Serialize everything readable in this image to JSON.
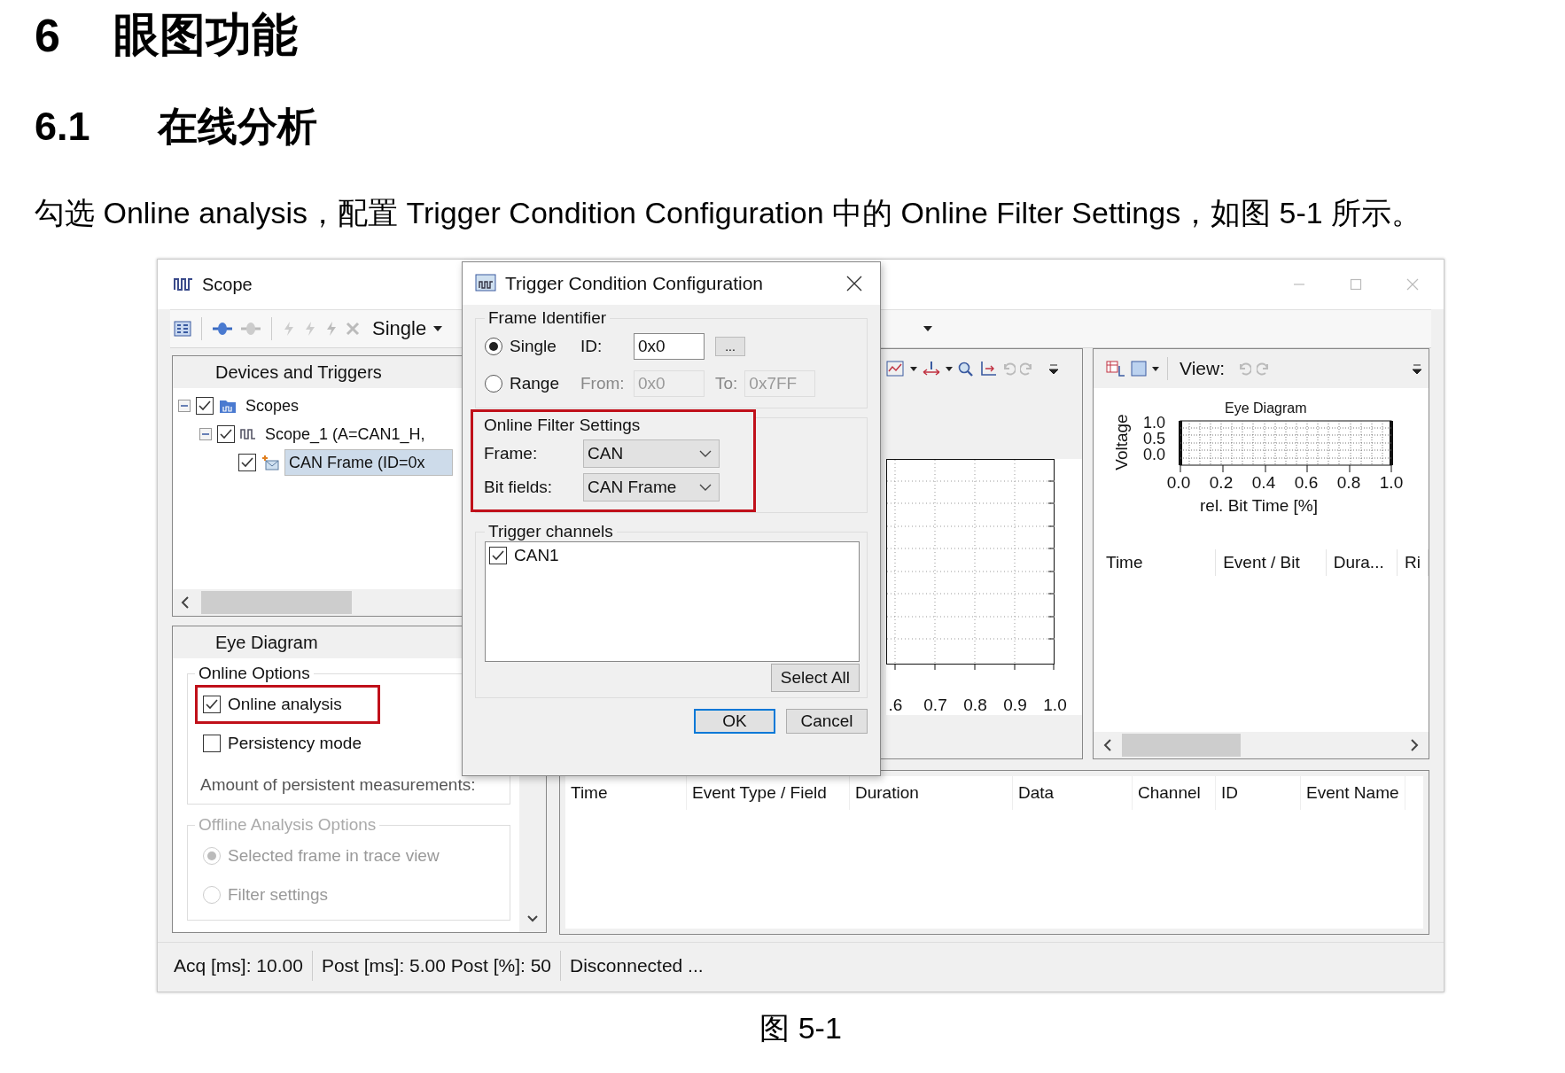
{
  "doc": {
    "heading1": {
      "number": "6",
      "title": "眼图功能"
    },
    "heading2": {
      "number": "6.1",
      "title": "在线分析"
    },
    "paragraph": "勾选 Online analysis，配置 Trigger Condition Configuration 中的 Online Filter Settings，如图 5-1 所示。",
    "caption": "图 5-1"
  },
  "window": {
    "title": "Scope"
  },
  "toolbar": {
    "mode": "Single"
  },
  "devices_panel": {
    "title": "Devices and Triggers",
    "tree": [
      {
        "label": "Scopes",
        "kind": "folder",
        "checked": true,
        "expanded": true,
        "selected": false,
        "children": [
          {
            "label": "Scope_1 (A=CAN1_H,",
            "kind": "scope",
            "checked": true,
            "expanded": true,
            "selected": false,
            "children": [
              {
                "label": "CAN Frame (ID=0x",
                "kind": "frame",
                "checked": true,
                "selected": true
              }
            ]
          }
        ]
      }
    ]
  },
  "eye_panel": {
    "title": "Eye Diagram",
    "online_options": {
      "title": "Online Options",
      "items": [
        {
          "label": "Online analysis",
          "checked": true,
          "highlighted": true
        },
        {
          "label": "Persistency mode",
          "checked": false,
          "highlighted": false
        }
      ],
      "amount_label": "Amount of persistent measurements:"
    },
    "offline_options": {
      "title": "Offline Analysis Options",
      "disabled": true,
      "items": [
        {
          "label": "Selected frame in trace view",
          "selected": true
        },
        {
          "label": "Filter settings",
          "selected": false
        }
      ]
    }
  },
  "scope_chart": {
    "x_tick_labels": [
      ".6",
      "0.7",
      "0.8",
      "0.9",
      "1.0"
    ]
  },
  "eye_view": {
    "view_label": "View:",
    "chart": {
      "title": "Eye Diagram",
      "ylabel": "Voltage",
      "y_tick_labels": [
        "1.0",
        "0.5",
        "0.0"
      ],
      "x_tick_labels": [
        "0.0",
        "0.2",
        "0.4",
        "0.6",
        "0.8",
        "1.0"
      ],
      "xlabel": "rel. Bit Time [%]"
    },
    "columns": [
      "Time",
      "Event / Bit",
      "Dura...",
      "Ri"
    ]
  },
  "event_table": {
    "columns": [
      "Time",
      "Event Type / Field",
      "Duration",
      "Data",
      "Channel",
      "ID",
      "Event Name"
    ]
  },
  "status_bar": [
    "Acq [ms]: 10.00",
    "Post [ms]: 5.00 Post [%]: 50",
    "Disconnected ..."
  ],
  "dialog": {
    "title": "Trigger Condition Configuration",
    "frame_identifier": {
      "title": "Frame Identifier",
      "modes": [
        {
          "label": "Single",
          "selected": true
        },
        {
          "label": "Range",
          "selected": false
        }
      ],
      "id_label": "ID:",
      "id_value": "0x0",
      "browse_button": "...",
      "from_label": "From:",
      "from_value": "0x0",
      "to_label": "To:",
      "to_value": "0x7FF"
    },
    "online_filter": {
      "title": "Online Filter Settings",
      "highlighted": true,
      "frame_label": "Frame:",
      "frame_value": "CAN",
      "bitfields_label": "Bit fields:",
      "bitfields_value": "CAN Frame"
    },
    "trigger_channels": {
      "title": "Trigger channels",
      "items": [
        {
          "label": "CAN1",
          "checked": true
        }
      ],
      "select_all": "Select All"
    },
    "buttons": [
      {
        "label": "OK",
        "default": true
      },
      {
        "label": "Cancel",
        "default": false
      }
    ]
  }
}
